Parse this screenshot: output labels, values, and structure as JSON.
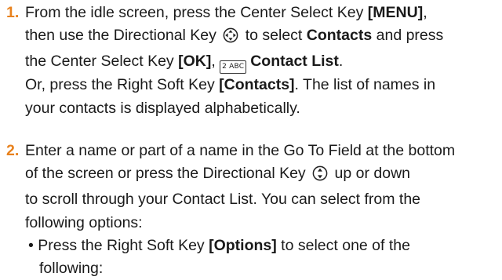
{
  "step1": {
    "number": "1.",
    "l1_text": "From the idle screen, press the Center Select Key ",
    "l1_key": "[MENU]",
    "l1_end": ",",
    "l2_a": "then use the Directional Key ",
    "l2_b": " to select ",
    "l2_contacts": "Contacts",
    "l2_c": " and press",
    "l3_a": "the Center Select Key ",
    "l3_ok": "[OK]",
    "l3_b": ", ",
    "l3_icon_text": "2 ABC",
    "l3_contact_list": "Contact List",
    "l3_end": ".",
    "l4_a": "Or, press the Right Soft Key ",
    "l4_key": "[Contacts]",
    "l4_b": ". The list of names in",
    "l5": "your contacts is displayed alphabetically."
  },
  "step2": {
    "number": "2.",
    "l1": "Enter a name or part of a name in the Go To Field at the bottom",
    "l2_a": "of the screen or press the Directional Key ",
    "l2_b": " up or down",
    "l3": "to scroll through your Contact List. You can select from the",
    "l4": "following options:",
    "bullet_a": "• Press the Right Soft Key ",
    "bullet_key": "[Options]",
    "bullet_b": " to select one of the",
    "bullet_cont": "following:"
  },
  "icons": {
    "four_way": "directional-key-four-way-icon",
    "up_down": "directional-key-up-down-icon",
    "contact_list": "contact-list-key-icon"
  },
  "colors": {
    "step_number": "#e8821e",
    "text": "#1a1a1a"
  }
}
